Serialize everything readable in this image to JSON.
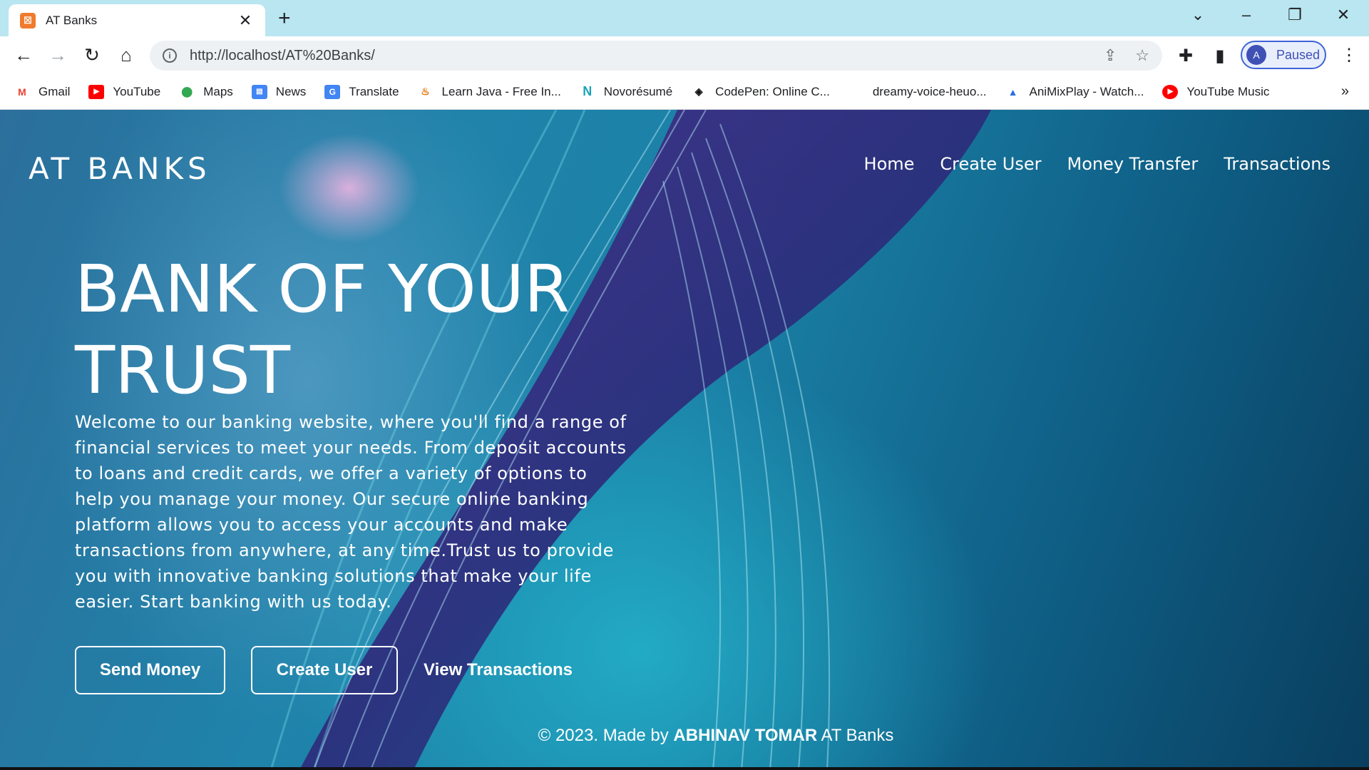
{
  "browser": {
    "tab_title": "AT Banks",
    "tab_favicon": "xampp-icon",
    "url": "http://localhost/AT%20Banks/",
    "profile_initial": "A",
    "profile_status": "Paused",
    "bookmarks": [
      {
        "label": "Gmail",
        "icon": "gmail-icon"
      },
      {
        "label": "YouTube",
        "icon": "youtube-icon"
      },
      {
        "label": "Maps",
        "icon": "maps-icon"
      },
      {
        "label": "News",
        "icon": "news-icon"
      },
      {
        "label": "Translate",
        "icon": "translate-icon"
      },
      {
        "label": "Learn Java - Free In...",
        "icon": "java-icon"
      },
      {
        "label": "Novorésumé",
        "icon": "novoresume-icon"
      },
      {
        "label": "CodePen: Online C...",
        "icon": "codepen-icon"
      },
      {
        "label": "dreamy-voice-heuo...",
        "icon": "blank-page-icon"
      },
      {
        "label": "AniMixPlay - Watch...",
        "icon": "animixplay-icon"
      },
      {
        "label": "YouTube Music",
        "icon": "youtube-music-icon"
      }
    ]
  },
  "site": {
    "brand": "AT BANKS",
    "nav": [
      "Home",
      "Create User",
      "Money Transfer",
      "Transactions"
    ],
    "hero_title": "BANK OF YOUR TRUST",
    "hero_text": "Welcome to our banking website, where you'll find a range of financial services to meet your needs. From deposit accounts to loans and credit cards, we offer a variety of options to help you manage your money. Our secure online banking platform allows you to access your accounts and make transactions from anywhere, at any time.Trust us to provide you with innovative banking solutions that make your life easier. Start banking with us today.",
    "buttons": {
      "send_money": "Send Money",
      "create_user": "Create User",
      "view_transactions": "View Transactions"
    },
    "footer": {
      "prefix": "© 2023. Made by",
      "author": "ABHINAV TOMAR",
      "suffix": "AT Banks"
    }
  }
}
